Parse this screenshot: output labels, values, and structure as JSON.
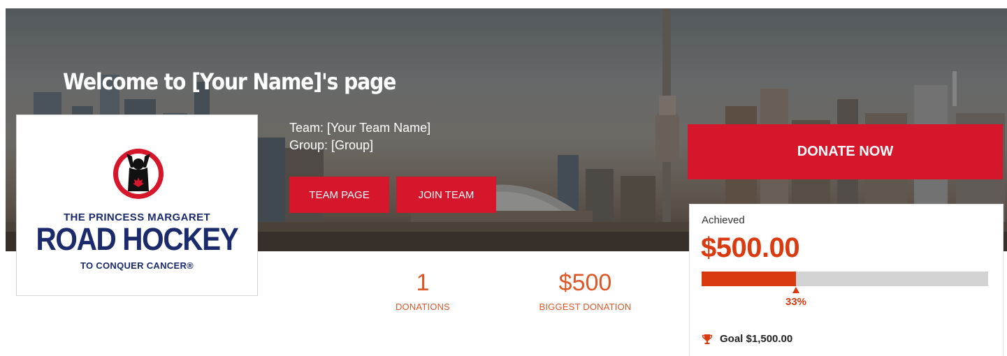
{
  "hero": {
    "welcome_title": "Welcome to [Your Name]'s page"
  },
  "logo": {
    "line1": "THE PRINCESS MARGARET",
    "line2": "ROAD HOCKEY",
    "line3": "TO CONQUER CANCER®",
    "brand_color": "#1b2a6b",
    "emblem_color": "#d5162b"
  },
  "team": {
    "team_line": "Team: [Your Team Name]",
    "group_line": "Group: [Group]",
    "team_page_label": "TEAM PAGE",
    "join_team_label": "JOIN TEAM"
  },
  "stats": {
    "donations_count": "1",
    "donations_label": "DONATIONS",
    "biggest_amount": "$500",
    "biggest_label": "BIGGEST DONATION"
  },
  "donation": {
    "donate_label": "DONATE NOW",
    "achieved_label": "Achieved",
    "achieved_amount": "$500.00",
    "progress_fraction": 0.33,
    "progress_pct_label": "33%",
    "goal_label": "Goal $1,500.00",
    "goal_icon": "trophy-icon"
  },
  "colors": {
    "button_red": "#d5162b",
    "accent_orange": "#dd5728",
    "progress_red": "#d93a10",
    "track_gray": "#d3d3d3"
  }
}
